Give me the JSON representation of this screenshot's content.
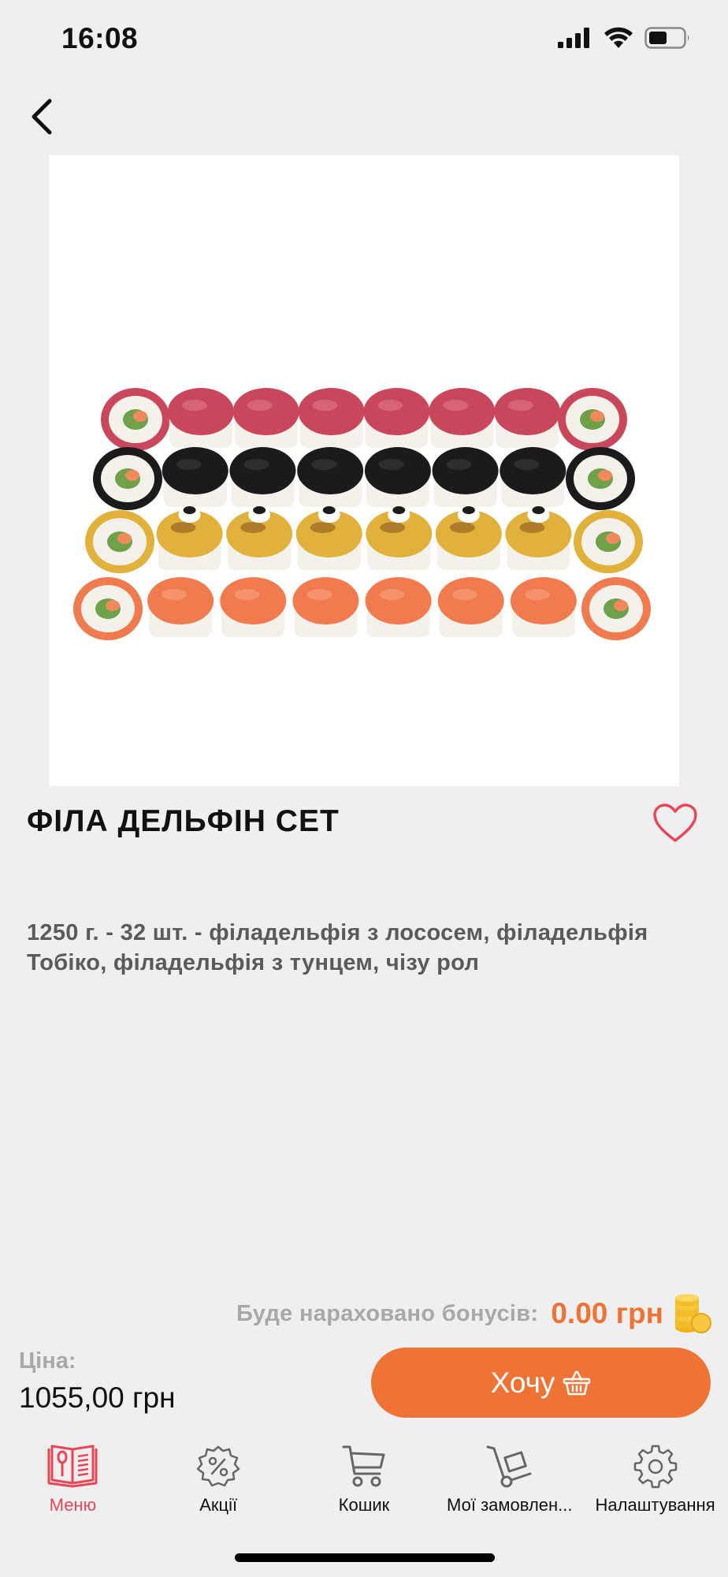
{
  "status_bar": {
    "time": "16:08"
  },
  "product": {
    "title": "ФІЛА ДЕЛЬФІН СЕТ",
    "description": "1250 г. - 32 шт. - філадельфія з лососем, філадельфія Тобіко, філадельфія з тунцем, чізу рол"
  },
  "bonus": {
    "label": "Буде нараховано бонусів:",
    "value": "0.00 грн"
  },
  "price": {
    "label": "Ціна:",
    "value": "1055,00 грн"
  },
  "cta": {
    "label": "Хочу"
  },
  "tabs": [
    {
      "label": "Меню",
      "icon": "menu-book-icon",
      "active": true
    },
    {
      "label": "Акції",
      "icon": "percent-badge-icon",
      "active": false
    },
    {
      "label": "Кошик",
      "icon": "cart-icon",
      "active": false
    },
    {
      "label": "Мої замовлен...",
      "icon": "hand-truck-icon",
      "active": false
    },
    {
      "label": "Налаштування",
      "icon": "gear-icon",
      "active": false
    }
  ],
  "colors": {
    "accent": "#ee7335",
    "active_tab": "#e8475a",
    "background": "#efefef",
    "favorite": "#e8475a"
  }
}
